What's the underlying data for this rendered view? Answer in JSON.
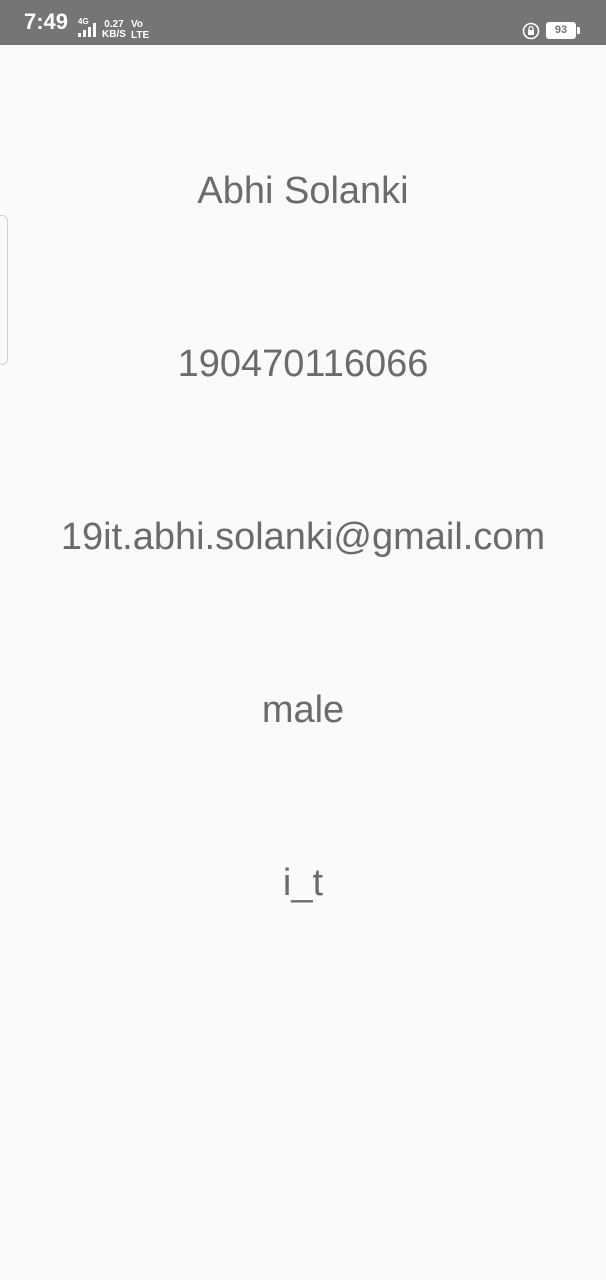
{
  "status_bar": {
    "time": "7:49",
    "network_type": "4G",
    "speed_value": "0.27",
    "speed_unit": "KB/S",
    "volte_top": "Vo",
    "volte_bottom": "LTE",
    "battery": "93",
    "icons": [
      "signal-icon",
      "lock-rotation-icon",
      "battery-icon"
    ]
  },
  "profile": {
    "name": "Abhi Solanki",
    "enrollment": "190470116066",
    "email": "19it.abhi.solanki@gmail.com",
    "gender": "male",
    "branch": "i_t"
  },
  "colors": {
    "status_bar_bg": "#757575",
    "page_bg": "#fafafa",
    "text": "#6b6b6b"
  }
}
